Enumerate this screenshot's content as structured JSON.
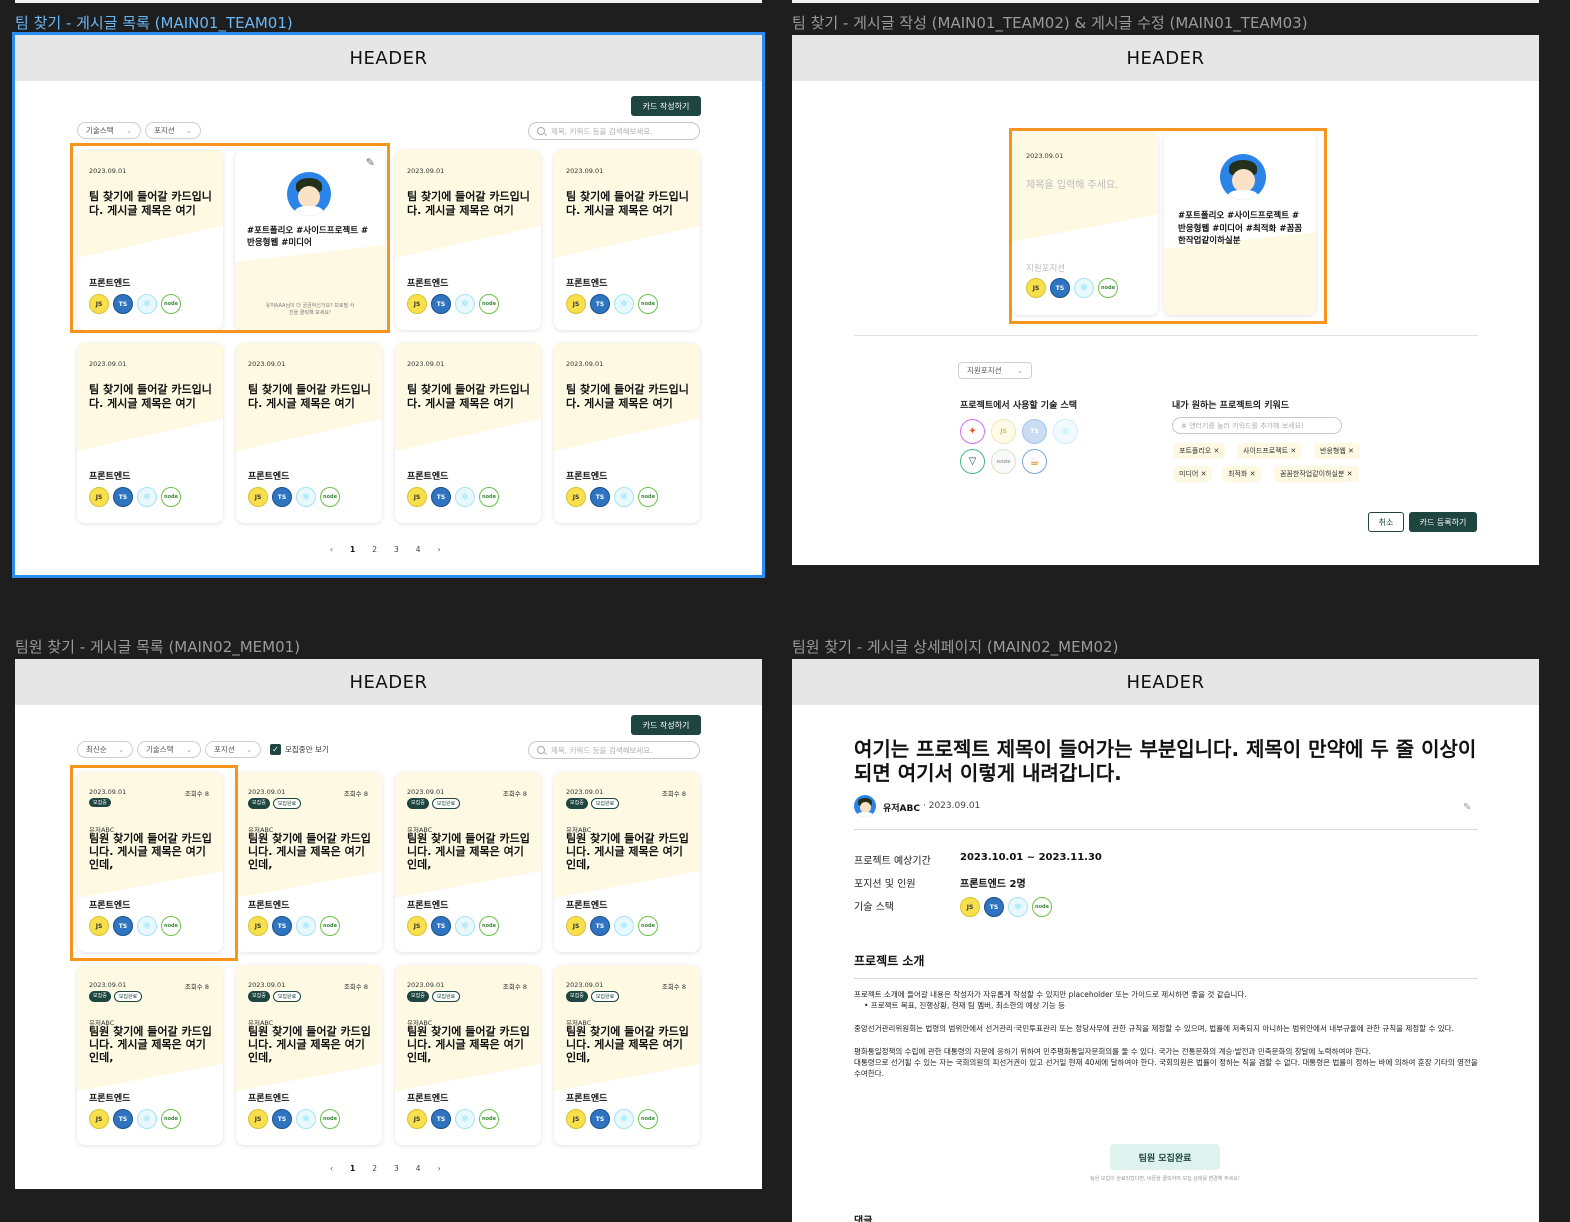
{
  "frames": {
    "team01_title": "팀 찾기 - 게시글 목록 (MAIN01_TEAM01)",
    "team02_title": "팀 찾기 - 게시글 작성 (MAIN01_TEAM02) & 게시글 수정 (MAIN01_TEAM03)",
    "mem01_title": "팀원 찾기 - 게시글 목록 (MAIN02_MEM01)",
    "mem02_title": "팀원 찾기 - 게시글 상세페이지 (MAIN02_MEM02)",
    "header": "HEADER"
  },
  "common": {
    "write_button": "카드 작성하기",
    "filter_stack": "기술스택",
    "filter_position": "포지션",
    "filter_sort": "최신순",
    "recruiting_only": "모집중만 보기",
    "search_placeholder": "제목, 키워드 등을 검색해보세요.",
    "pages": [
      "‹",
      "1",
      "2",
      "3",
      "4",
      "›"
    ],
    "stack_icons": [
      "JS",
      "TS",
      "⚛",
      "node"
    ]
  },
  "team_card": {
    "date": "2023.09.01",
    "title": "팀 찾기에 들어갈 카드입니다. 게시글 제목은 여기",
    "position": "프론트엔드",
    "hashtags": "#포트폴리오 #사이드프로젝트 #반응형웹 #미디어",
    "hint": "유저AAA님이 더 궁금하신가요? 프로필 사진을 클릭해 보세요!"
  },
  "member_card": {
    "date": "2023.09.01",
    "views": "조회수 8",
    "badge_on": "모집중",
    "badge_off": "모집완료",
    "user": "유저ABC",
    "title": "팀원 찾기에 들어갈 카드입니다. 게시글 제목은 여기인데,",
    "position": "프론트엔드"
  },
  "write": {
    "date": "2023.09.01",
    "title_placeholder": "제목을 입력해 주세요.",
    "position_placeholder": "지원포지션",
    "hashtags": "#포트폴리오 #사이드프로젝트 #반응형웹 #미디어 #최적화 #꼼꼼한작업같이하실분",
    "select_position": "지원포지션",
    "stack_label": "프로젝트에서 사용할 기술 스택",
    "keyword_label": "내가 원하는 프로젝트의 키워드",
    "keyword_placeholder": "#   엔터키를 눌러 키워드를 추가해 보세요!",
    "keywords": [
      "포트폴리오",
      "사이드프로젝트",
      "반응형웹",
      "미디어",
      "최적화",
      "꼼꼼한작업같이하실분"
    ],
    "cancel": "취소",
    "submit": "카드 등록하기"
  },
  "detail": {
    "title": "여기는 프로젝트 제목이 들어가는 부분입니다. 제목이 만약에 두 줄 이상이 되면 여기서 이렇게 내려갑니다.",
    "author": "유저ABC",
    "date": "2023.09.01",
    "period_label": "프로젝트 예상기간",
    "period_value": "2023.10.01 ~ 2023.11.30",
    "position_label": "포지션 및 인원",
    "position_value": "프론트엔드 2명",
    "stack_label": "기술 스택",
    "intro_heading": "프로젝트 소개",
    "intro_p1": "프로젝트 소개에 들어갈 내용은 작성자가 자유롭게 작성할 수 있지만 placeholder 또는 가이드로 제시하면 좋을 것 같습니다.",
    "intro_bullet": "• 프로젝트 목표, 진행상황, 현재 팀 멤버, 최소한의 예상 기능 등",
    "intro_p2": "중앙선거관리위원회는 법령의 범위안에서 선거관리·국민투표관리 또는 정당사무에 관한 규칙을 제정할 수 있으며, 법률에 저촉되지 아니하는 범위안에서 내부규율에 관한 규칙을 제정할 수 있다.",
    "intro_p3": "평화통일정책의 수립에 관한 대통령의 자문에 응하기 위하여 민주평화통일자문회의를 둘 수 있다. 국가는 전통문화의 계승·발전과 민족문화의 창달에 노력하여야 한다.",
    "intro_p4": "대통령으로 선거될 수 있는 자는 국회의원의 피선거권이 있고 선거일 현재 40세에 달하여야 한다. 국회의원은 법률이 정하는 직을 겸할 수 없다. 대통령은 법률이 정하는 바에 의하여 훈장 기타의 영전을 수여한다.",
    "complete_button": "팀원 모집완료",
    "complete_hint": "팀원 모집이 완료되었다면, 버튼을 클릭하여 모집 상태를 변경해 주세요!",
    "comment_label": "댓글"
  },
  "colors": {
    "accent": "#1e453f",
    "highlight": "#f7941d",
    "selection": "#2a8df0",
    "card_yellow": "#fdf9e2"
  }
}
